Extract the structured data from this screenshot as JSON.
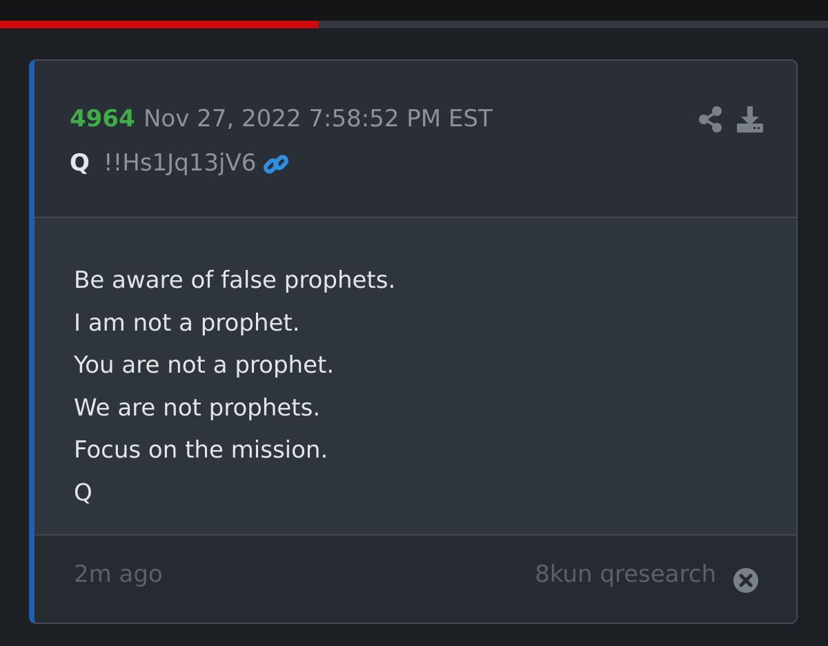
{
  "progress": {
    "fraction": 0.385,
    "fill_color": "#d0090b"
  },
  "post": {
    "number": "4964",
    "date": "Nov 27, 2022 7:58:52 PM EST",
    "author": "Q",
    "tripcode": "!!Hs1Jq13jV6",
    "icons": {
      "link": "link-icon",
      "share": "share-icon",
      "download": "download-icon",
      "close": "close-circle-icon"
    },
    "lines": [
      "Be aware of false prophets.",
      "I am not a prophet.",
      "You are not a prophet.",
      "We are not prophets.",
      "Focus on the mission.",
      "Q"
    ],
    "time_ago": "2m ago",
    "source": "8kun qresearch"
  },
  "colors": {
    "accent": "#1f5fae",
    "number": "#3fae49",
    "link": "#2f8ee0"
  }
}
